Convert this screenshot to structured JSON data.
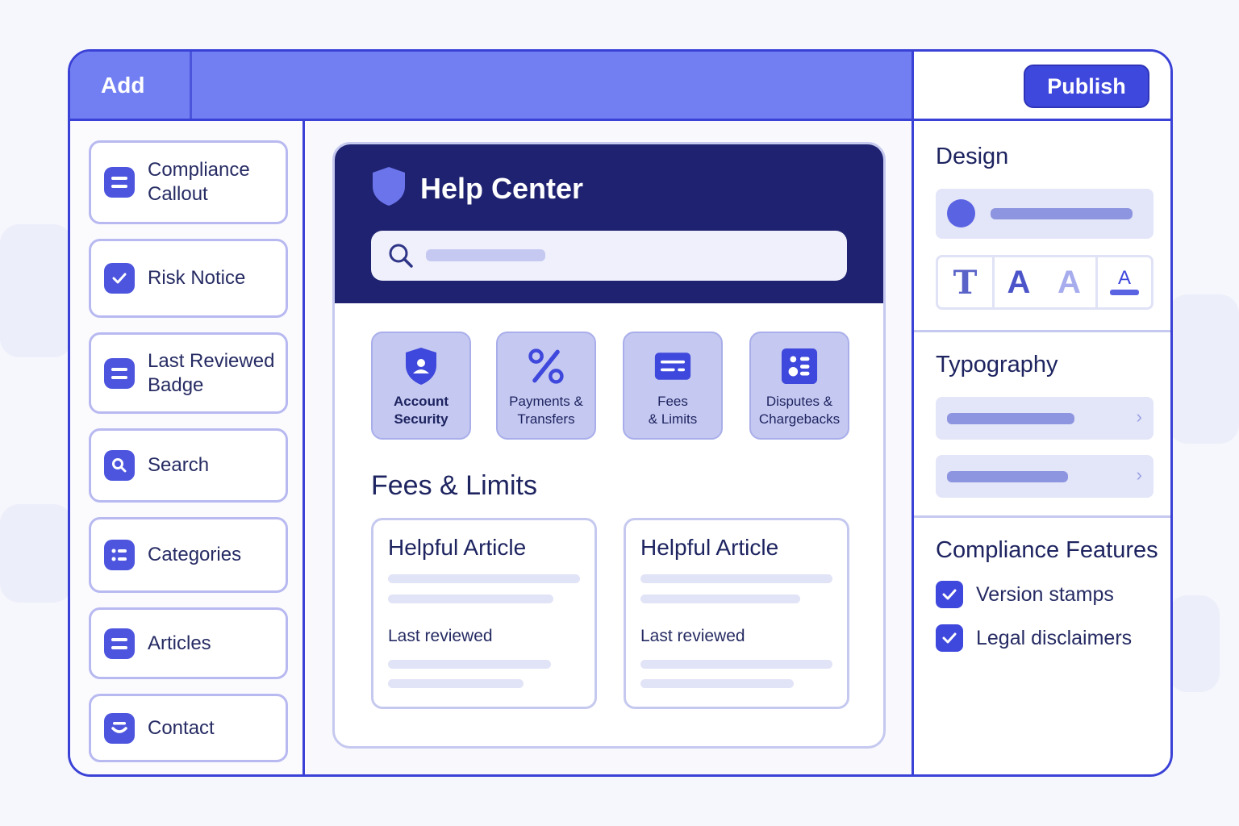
{
  "toolbar": {
    "add_label": "Add",
    "publish_label": "Publish"
  },
  "sidebar": {
    "items": [
      {
        "label": "Compliance\nCallout",
        "icon": "list-icon"
      },
      {
        "label": "Risk Notice",
        "icon": "checkbox-icon"
      },
      {
        "label": "Last Reviewed\nBadge",
        "icon": "list-icon"
      },
      {
        "label": "Search",
        "icon": "search-icon"
      },
      {
        "label": "Categories",
        "icon": "categories-icon"
      },
      {
        "label": "Articles",
        "icon": "list-icon"
      },
      {
        "label": "Contact",
        "icon": "contact-icon"
      }
    ]
  },
  "preview": {
    "title": "Help Center",
    "categories": [
      {
        "label": "Account\nSecurity",
        "icon": "shield-user-icon"
      },
      {
        "label": "Payments &\nTransfers",
        "icon": "percent-icon"
      },
      {
        "label": "Fees\n& Limits",
        "icon": "card-icon"
      },
      {
        "label": "Disputes &\nChargebacks",
        "icon": "grid-icon"
      }
    ],
    "section_title": "Fees & Limits",
    "articles": [
      {
        "title": "Helpful Article",
        "reviewed": "Last reviewed"
      },
      {
        "title": "Helpful Article",
        "reviewed": "Last reviewed"
      }
    ]
  },
  "design_panel": {
    "design_title": "Design",
    "typography_title": "Typography",
    "compliance_title": "Compliance Features",
    "font_tools": [
      "T",
      "A",
      "A",
      "A"
    ],
    "features": [
      {
        "label": "Version stamps",
        "checked": true
      },
      {
        "label": "Legal disclaimers",
        "checked": true
      }
    ]
  },
  "colors": {
    "accent": "#3f48dc",
    "topbar": "#727ff2",
    "header": "#1f2270",
    "card": "#c5c9f1"
  }
}
